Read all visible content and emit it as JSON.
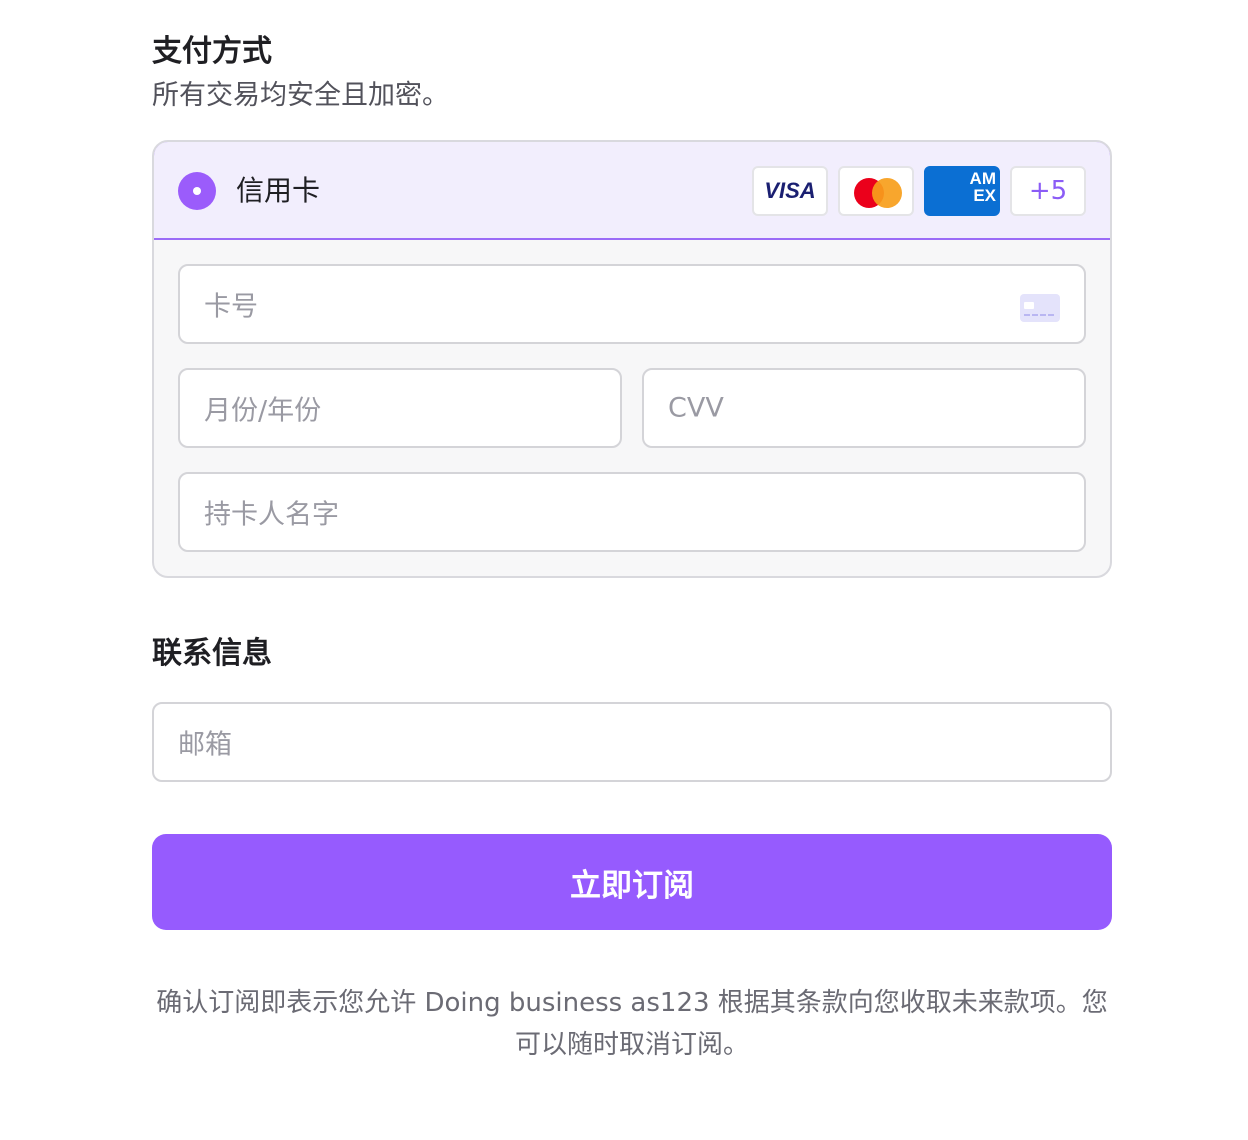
{
  "payment": {
    "title": "支付方式",
    "subtitle": "所有交易均安全且加密。",
    "method_label": "信用卡",
    "brands": {
      "visa": "VISA",
      "amex": "AM EX",
      "more": "+5"
    },
    "fields": {
      "card_number_placeholder": "卡号",
      "expiry_placeholder": "月份/年份",
      "cvv_placeholder": "CVV",
      "cardholder_placeholder": "持卡人名字"
    },
    "icons": {
      "radio": "radio-selected-icon",
      "card": "credit-card-icon",
      "mastercard": "mastercard-logo"
    },
    "accent_color": "#965bfe"
  },
  "contact": {
    "title": "联系信息",
    "email_placeholder": "邮箱"
  },
  "subscribe_button": "立即订阅",
  "terms_text": "确认订阅即表示您允许 Doing business as123 根据其条款向您收取未来款项。您可以随时取消订阅。"
}
